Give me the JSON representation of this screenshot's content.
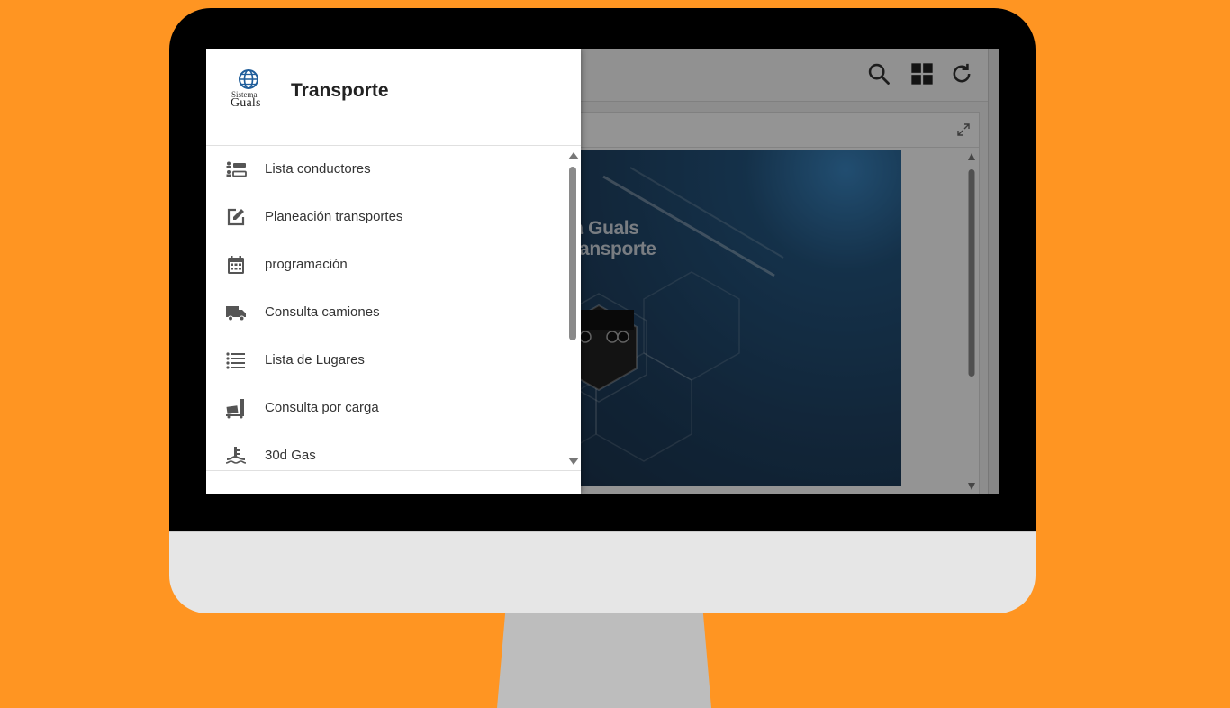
{
  "colors": {
    "background": "#ff9522",
    "bezel": "#000000",
    "chin": "#e6e6e6",
    "stand": "#bdbdbd",
    "icon": "#555555"
  },
  "app": {
    "header_icons": [
      "search-icon",
      "grid-view-icon",
      "refresh-icon"
    ],
    "banner": {
      "title_line1": "na Guals",
      "title_line2": "Transporte"
    }
  },
  "drawer": {
    "logo": {
      "line1": "Sistema",
      "line2": "Guals"
    },
    "title": "Transporte",
    "items": [
      {
        "label": "Lista conductores",
        "icon": "driver-list-icon"
      },
      {
        "label": "Planeación transportes",
        "icon": "edit-icon"
      },
      {
        "label": "programación",
        "icon": "calendar-icon"
      },
      {
        "label": "Consulta camiones",
        "icon": "truck-icon"
      },
      {
        "label": "Lista de Lugares",
        "icon": "list-icon"
      },
      {
        "label": "Consulta por carga",
        "icon": "cargo-icon"
      },
      {
        "label": "30d Gas",
        "icon": "gas-icon"
      }
    ]
  }
}
